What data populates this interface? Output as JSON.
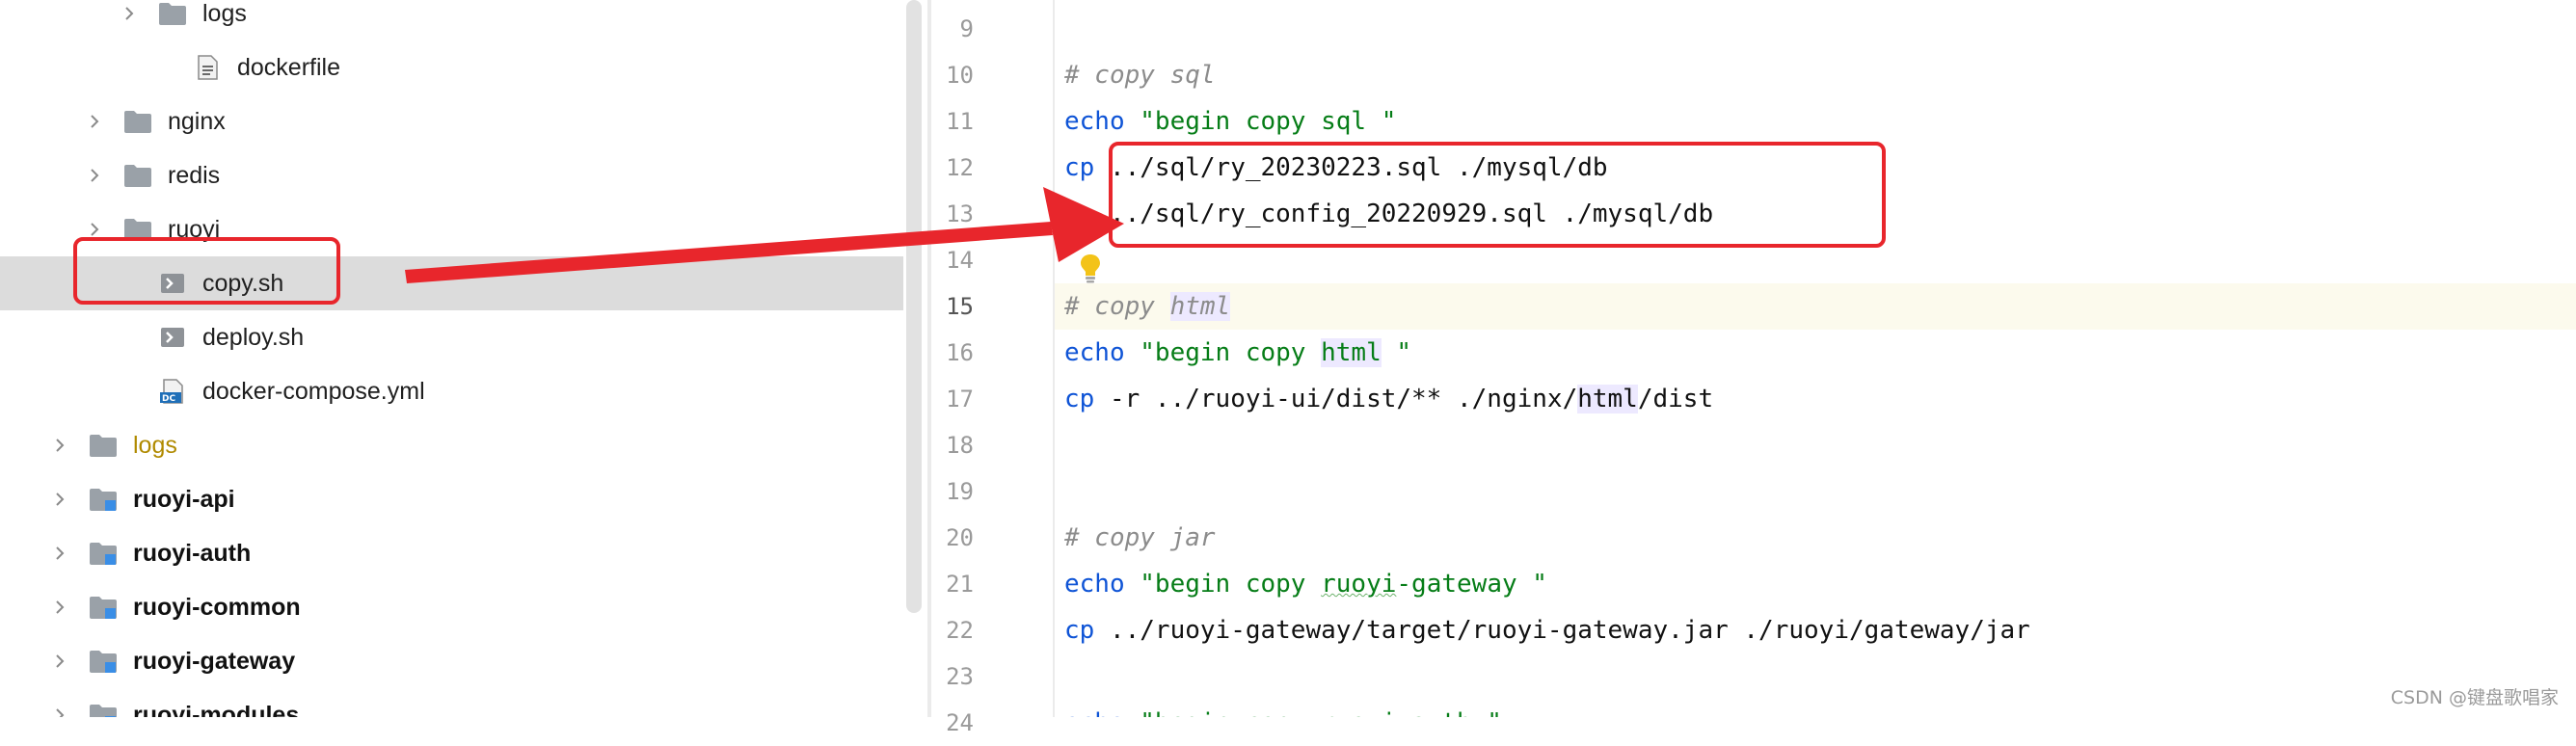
{
  "tree": {
    "items": [
      {
        "label": "logs",
        "icon": "folder",
        "level": 3,
        "chevron": true
      },
      {
        "label": "dockerfile",
        "icon": "file-text",
        "level": 4,
        "chevron": false
      },
      {
        "label": "nginx",
        "icon": "folder",
        "level": 2,
        "chevron": true
      },
      {
        "label": "redis",
        "icon": "folder",
        "level": 2,
        "chevron": true
      },
      {
        "label": "ruoyi",
        "icon": "folder",
        "level": 2,
        "chevron": true
      },
      {
        "label": "copy.sh",
        "icon": "shell-file",
        "level": 3,
        "chevron": false,
        "selected": true
      },
      {
        "label": "deploy.sh",
        "icon": "shell-file",
        "level": 3,
        "chevron": false
      },
      {
        "label": "docker-compose.yml",
        "icon": "docker-compose-file",
        "level": 3,
        "chevron": false
      },
      {
        "label": "logs",
        "icon": "folder",
        "level": 1,
        "chevron": true,
        "excluded": true
      },
      {
        "label": "ruoyi-api",
        "icon": "module-folder",
        "level": 1,
        "chevron": true,
        "bold": true
      },
      {
        "label": "ruoyi-auth",
        "icon": "module-folder",
        "level": 1,
        "chevron": true,
        "bold": true
      },
      {
        "label": "ruoyi-common",
        "icon": "module-folder",
        "level": 1,
        "chevron": true,
        "bold": true
      },
      {
        "label": "ruoyi-gateway",
        "icon": "module-folder",
        "level": 1,
        "chevron": true,
        "bold": true
      },
      {
        "label": "ruoyi-modules",
        "icon": "module-folder",
        "level": 1,
        "chevron": true,
        "bold": true
      }
    ]
  },
  "editor": {
    "current_line": "15",
    "lines": [
      {
        "num": "9",
        "text": ""
      },
      {
        "num": "10",
        "text": "# copy sql"
      },
      {
        "num": "11",
        "text": "echo \"begin copy sql \""
      },
      {
        "num": "12",
        "text": "cp ../sql/ry_20230223.sql ./mysql/db"
      },
      {
        "num": "13",
        "text": "cp ../sql/ry_config_20220929.sql ./mysql/db"
      },
      {
        "num": "14",
        "text": ""
      },
      {
        "num": "15",
        "text": "# copy html"
      },
      {
        "num": "16",
        "text": "echo \"begin copy html \""
      },
      {
        "num": "17",
        "text": "cp -r ../ruoyi-ui/dist/** ./nginx/html/dist"
      },
      {
        "num": "18",
        "text": ""
      },
      {
        "num": "19",
        "text": ""
      },
      {
        "num": "20",
        "text": "# copy jar"
      },
      {
        "num": "21",
        "text": "echo \"begin copy ruoyi-gateway \""
      },
      {
        "num": "22",
        "text": "cp ../ruoyi-gateway/target/ruoyi-gateway.jar ./ruoyi/gateway/jar"
      },
      {
        "num": "23",
        "text": ""
      },
      {
        "num": "24",
        "text": "echo \"begin copy ruoyi-auth \""
      }
    ]
  },
  "colors": {
    "keyword": "#0f54d6",
    "string": "#067d17",
    "comment": "#8c8c8c",
    "annotation_red": "#e8262c",
    "selection": "#dcdcdc",
    "current_line": "#fcfaed"
  },
  "watermark": "CSDN @键盘歌唱家"
}
